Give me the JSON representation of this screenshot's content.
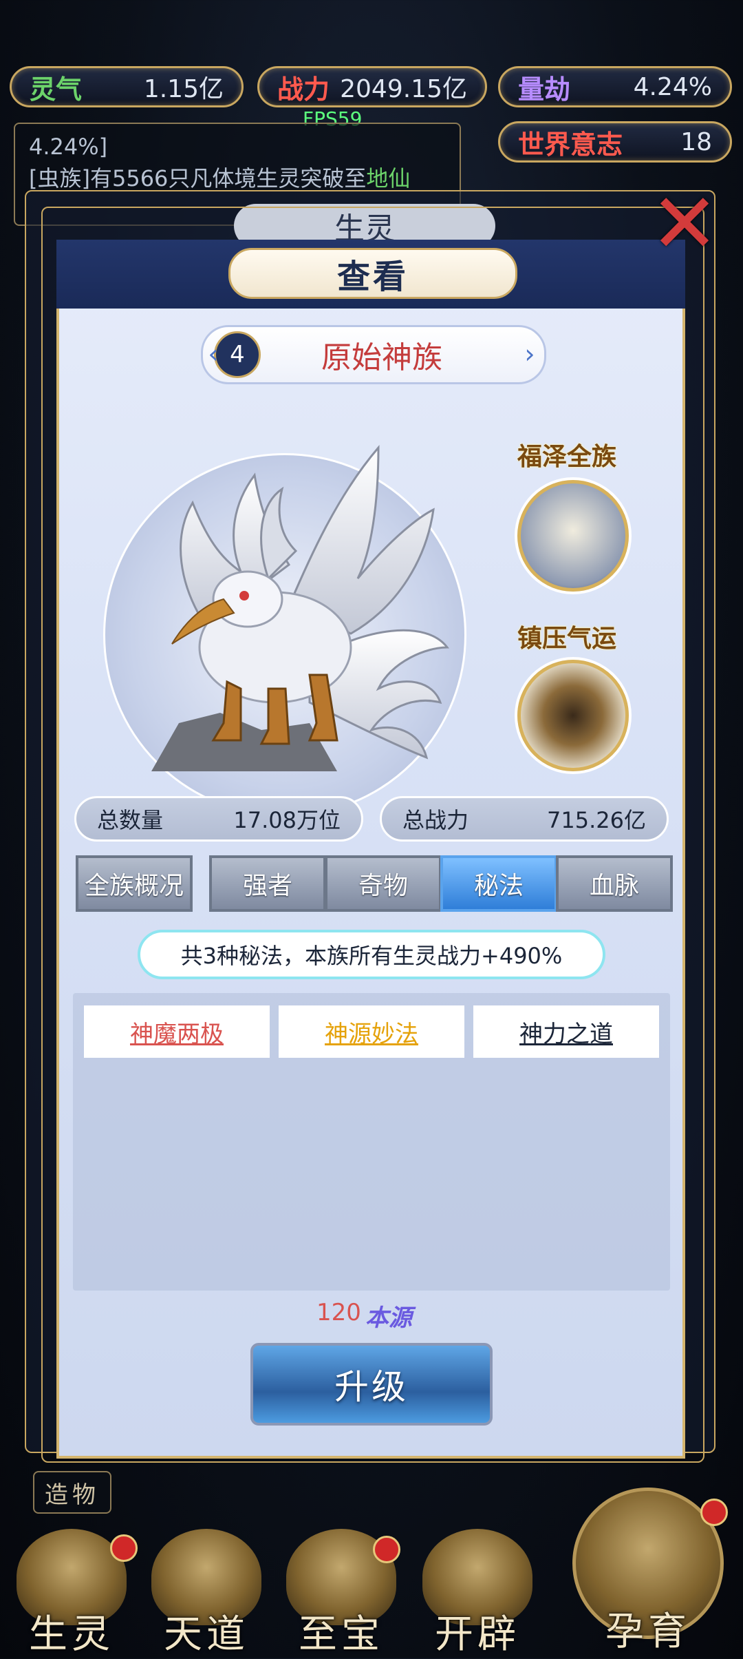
{
  "stats": [
    {
      "label": "灵气",
      "value": "1.15亿",
      "color": "green"
    },
    {
      "label": "战力",
      "value": "2049.15亿",
      "color": "red"
    },
    {
      "label": "量劫",
      "value": "4.24%",
      "color": "purple"
    },
    {
      "label": "世界意志",
      "value": "18",
      "color": "red"
    }
  ],
  "fps": "FPS59",
  "log": {
    "line1": "4.24%]",
    "line2_prefix": "[虫族]有5566只凡体境生灵突破至",
    "line2_highlight": "地仙"
  },
  "bg_title": "生灵",
  "dialog": {
    "title": "查看",
    "race_level": "4",
    "race_name": "原始神族"
  },
  "side": {
    "blessing_title": "福泽全族",
    "suppress_title": "镇压气运"
  },
  "totals": {
    "count_label": "总数量",
    "count_value": "17.08万位",
    "power_label": "总战力",
    "power_value": "715.26亿"
  },
  "tabs": [
    {
      "label": "全族概况",
      "active": false
    },
    {
      "label": "强者",
      "active": false
    },
    {
      "label": "奇物",
      "active": false
    },
    {
      "label": "秘法",
      "active": true
    },
    {
      "label": "血脉",
      "active": false
    }
  ],
  "summary": "共3种秘法，本族所有生灵战力+490%",
  "skills": [
    {
      "label": "神魔两极",
      "color": "#d9534f"
    },
    {
      "label": "神源妙法",
      "color": "#e5a20a"
    },
    {
      "label": "神力之道",
      "color": "#1b2538"
    }
  ],
  "cost": {
    "amount": "120",
    "unit": "本源"
  },
  "upgrade_label": "升级",
  "zaowu_label": "造物",
  "nav": [
    {
      "label": "生灵"
    },
    {
      "label": "天道"
    },
    {
      "label": "至宝"
    },
    {
      "label": "开辟"
    },
    {
      "label": "孕育"
    }
  ]
}
